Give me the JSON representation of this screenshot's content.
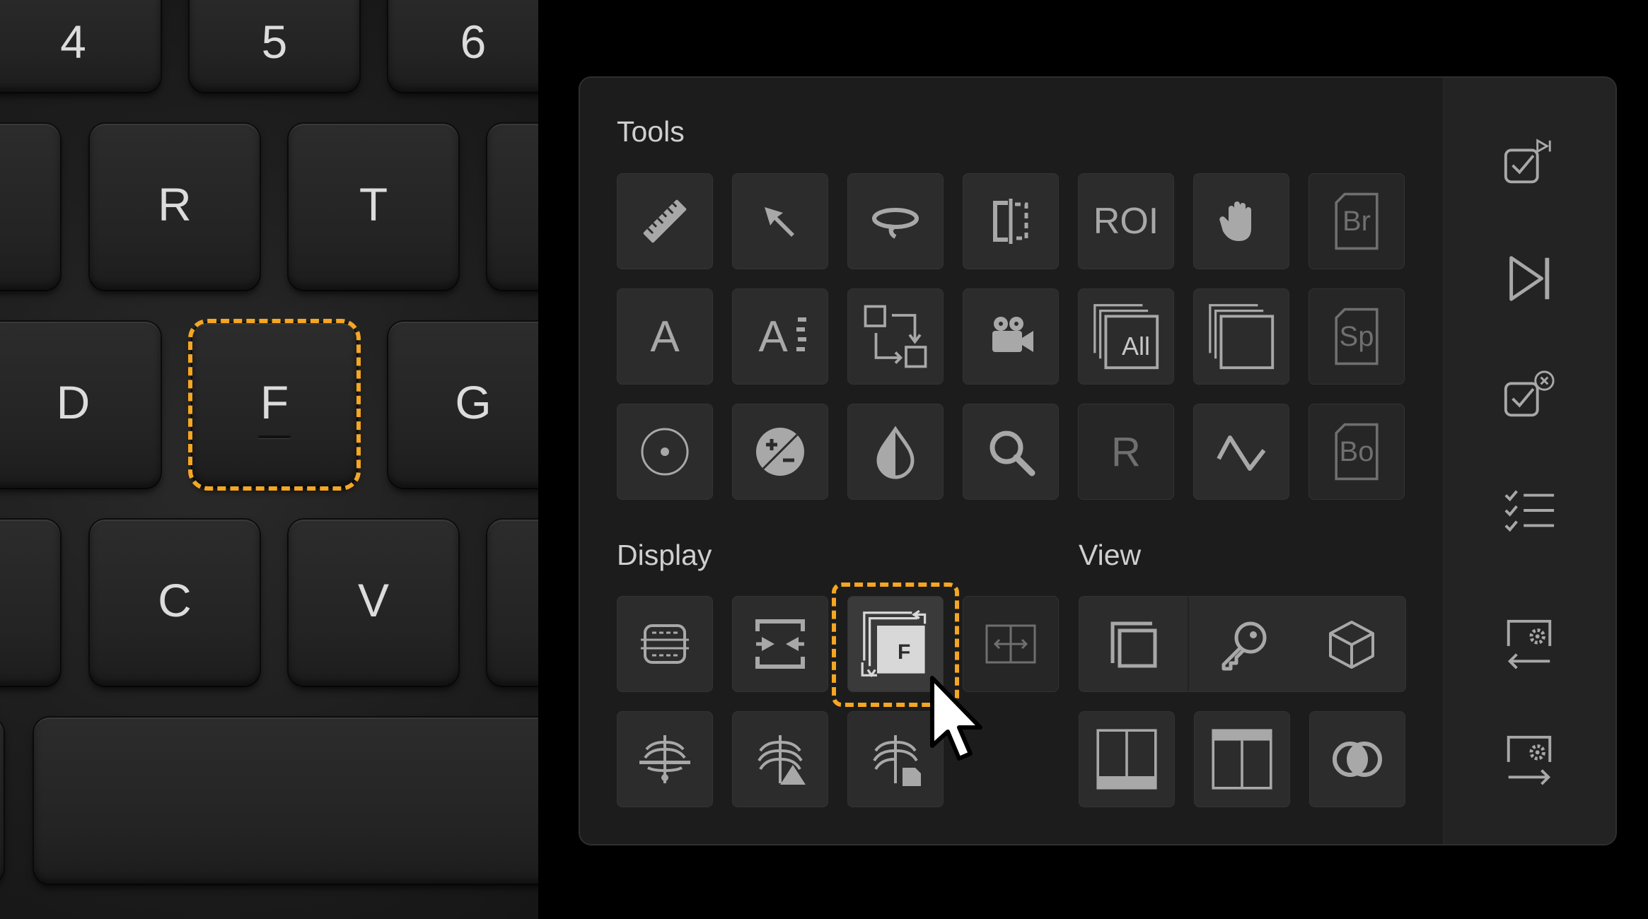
{
  "keyboard": {
    "keys": {
      "k4": "4",
      "k5": "5",
      "k6": "6",
      "r": "R",
      "t": "T",
      "d": "D",
      "f": "F",
      "g": "G",
      "c": "C",
      "v": "V"
    }
  },
  "panel": {
    "tools_title": "Tools",
    "display_title": "Display",
    "view_title": "View",
    "tools": {
      "roi": "ROI",
      "br": "Br",
      "text_a": "A",
      "text_a2": "A",
      "all": "All",
      "sp": "Sp",
      "r": "R",
      "bo": "Bo"
    },
    "display": {
      "fusion_key": "F"
    }
  },
  "colors": {
    "accent": "#f5a623",
    "panel_bg": "#1c1c1c",
    "tile_bg": "#2c2c2c",
    "icon": "#a8a8a8"
  }
}
